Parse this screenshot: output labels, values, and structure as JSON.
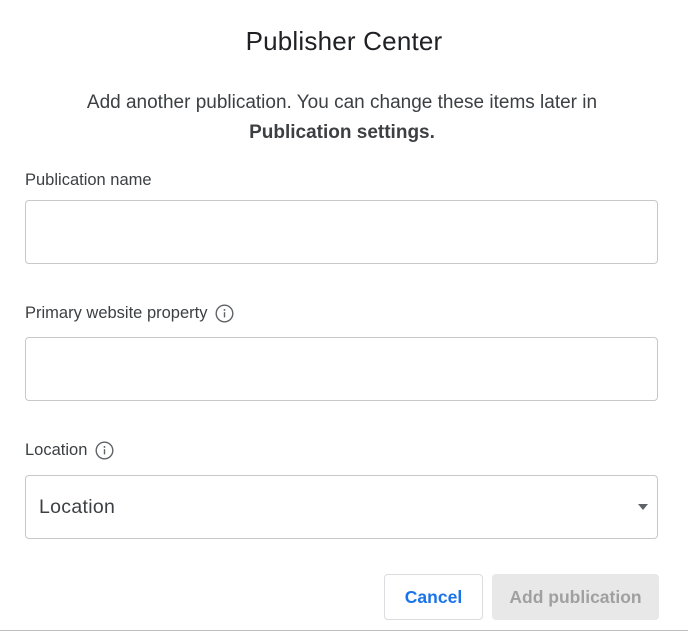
{
  "dialog": {
    "title": "Publisher Center",
    "subtitle_text": "Add another publication. You can change these items later in",
    "subtitle_bold": "Publication settings."
  },
  "fields": {
    "publication_name": {
      "label": "Publication name",
      "value": "",
      "placeholder": ""
    },
    "primary_website": {
      "label": "Primary website property",
      "value": "",
      "placeholder": "",
      "has_info_icon": true
    },
    "location": {
      "label": "Location",
      "selected_value": "Location",
      "has_info_icon": true
    }
  },
  "actions": {
    "cancel_label": "Cancel",
    "add_label": "Add publication"
  },
  "icons": {
    "info": "info-circle-icon",
    "dropdown": "chevron-down-icon"
  },
  "colors": {
    "accent": "#1a73e8",
    "disabled_bg": "#e8e8e8",
    "disabled_text": "#a0a0a0"
  }
}
